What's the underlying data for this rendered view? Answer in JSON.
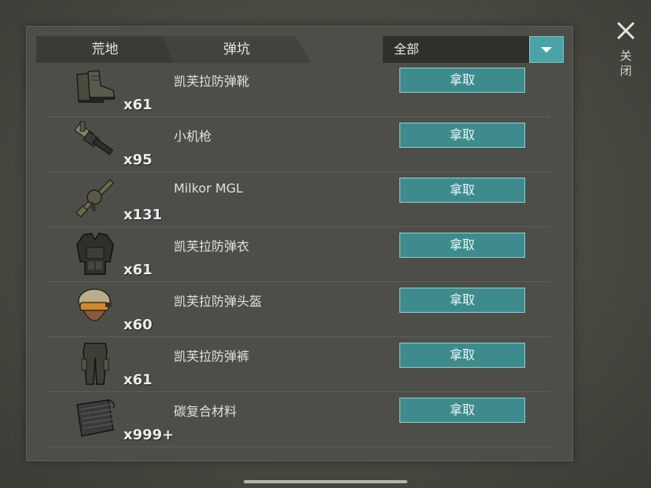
{
  "tabs": [
    {
      "label": "荒地",
      "active": true
    },
    {
      "label": "弹坑",
      "active": false
    }
  ],
  "filter": {
    "selected": "全部",
    "dropdown_icon": "triangle-down-icon"
  },
  "close": {
    "icon": "close-x-icon",
    "label": "关闭"
  },
  "items": [
    {
      "name": "凯芙拉防弹靴",
      "qty": "x61",
      "action": "拿取",
      "icon": "boots-icon"
    },
    {
      "name": "小机枪",
      "qty": "x95",
      "action": "拿取",
      "icon": "smg-icon"
    },
    {
      "name": "Milkor MGL",
      "qty": "x131",
      "action": "拿取",
      "icon": "grenade-launcher-icon"
    },
    {
      "name": "凯芙拉防弹衣",
      "qty": "x61",
      "action": "拿取",
      "icon": "body-armor-icon"
    },
    {
      "name": "凯芙拉防弹头盔",
      "qty": "x60",
      "action": "拿取",
      "icon": "helmet-icon"
    },
    {
      "name": "凯芙拉防弹裤",
      "qty": "x61",
      "action": "拿取",
      "icon": "armored-pants-icon"
    },
    {
      "name": "碳复合材料",
      "qty": "x999+",
      "action": "拿取",
      "icon": "carbon-sheet-icon"
    }
  ],
  "colors": {
    "accent": "#4aa3a6",
    "button": "#3e8b8d",
    "panel": "#4d4e48"
  }
}
